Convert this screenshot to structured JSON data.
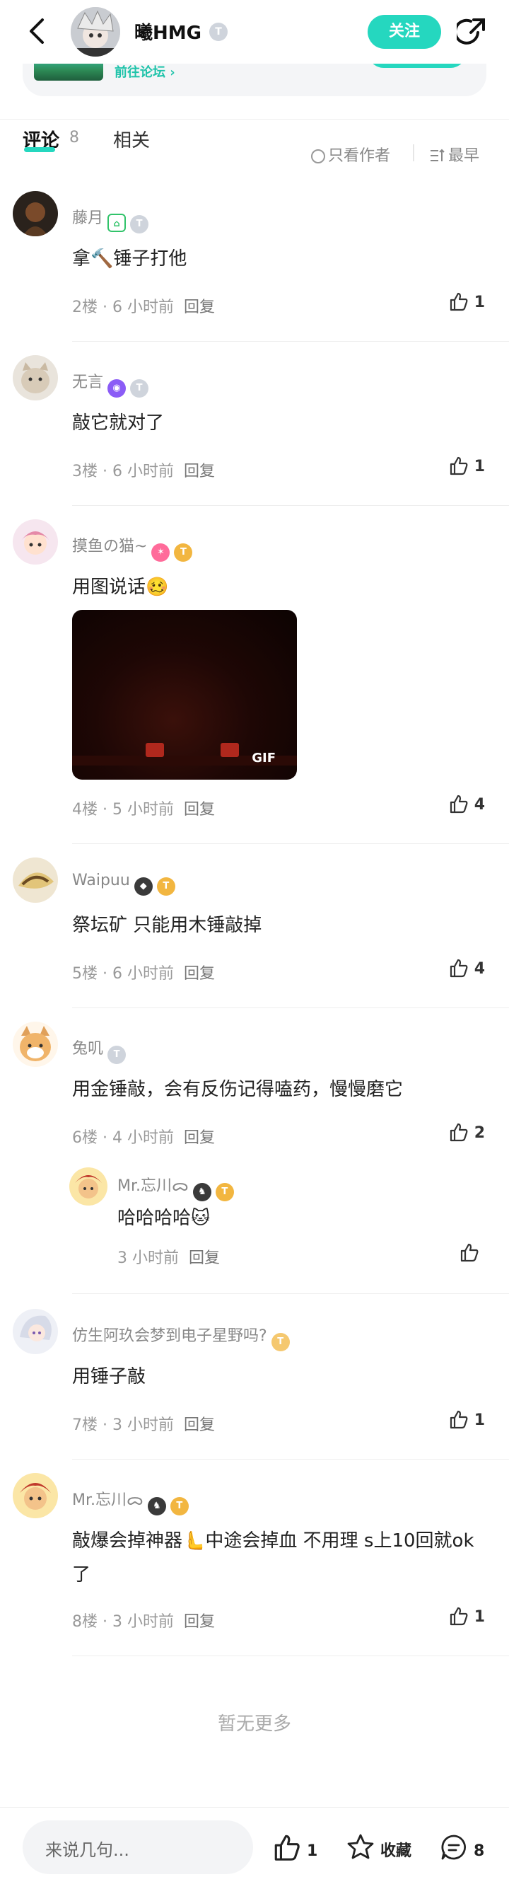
{
  "header": {
    "name": "曦HMG",
    "level_badge": "T",
    "follow_label": "关注"
  },
  "forum_card": {
    "link_label": "前往论坛 ›"
  },
  "tabs": {
    "comments_label": "评论",
    "comments_count": "8",
    "related_label": "相关",
    "only_author_label": "只看作者",
    "latest_label": "最早"
  },
  "comments": [
    {
      "name": "藤月",
      "text": "拿🔨锤子打他",
      "floor": "2楼",
      "time": "6 小时前",
      "reply": "回复",
      "likes": "1"
    },
    {
      "name": "无言",
      "text": "敲它就对了",
      "floor": "3楼",
      "time": "6 小时前",
      "reply": "回复",
      "likes": "1"
    },
    {
      "name": "摸鱼の猫~",
      "text": "用图说话🥴",
      "floor": "4楼",
      "time": "5 小时前",
      "reply": "回复",
      "likes": "4",
      "gif_label": "GIF"
    },
    {
      "name": "Waipuu",
      "text": "祭坛矿 只能用木锤敲掉",
      "floor": "5楼",
      "time": "6 小时前",
      "reply": "回复",
      "likes": "4"
    },
    {
      "name": "兔叽",
      "text": "用金锤敲，会有反伤记得嗑药，慢慢磨它",
      "floor": "6楼",
      "time": "4 小时前",
      "reply": "回复",
      "likes": "2"
    },
    {
      "name": "仿生阿玖会梦到电子星野吗?",
      "text": "用锤子敲",
      "floor": "7楼",
      "time": "3 小时前",
      "reply": "回复",
      "likes": "1"
    },
    {
      "name": "Mr.忘川ᯅ",
      "text": "敲爆会掉神器🫷中途会掉血 不用理 s上10回就ok了",
      "floor": "8楼",
      "time": "3 小时前",
      "reply": "回复",
      "likes": "1"
    }
  ],
  "sub_reply": {
    "name": "Mr.忘川ᯅ",
    "text": "哈哈哈哈🐱",
    "time": "3 小时前",
    "reply": "回复"
  },
  "footer_more": "暂无更多",
  "bottom_bar": {
    "input_placeholder": "来说几句...",
    "like_count": "1",
    "favorite_label": "收藏",
    "comment_count": "8"
  },
  "colors": {
    "accent": "#25d7bf",
    "text_muted": "#999999"
  }
}
